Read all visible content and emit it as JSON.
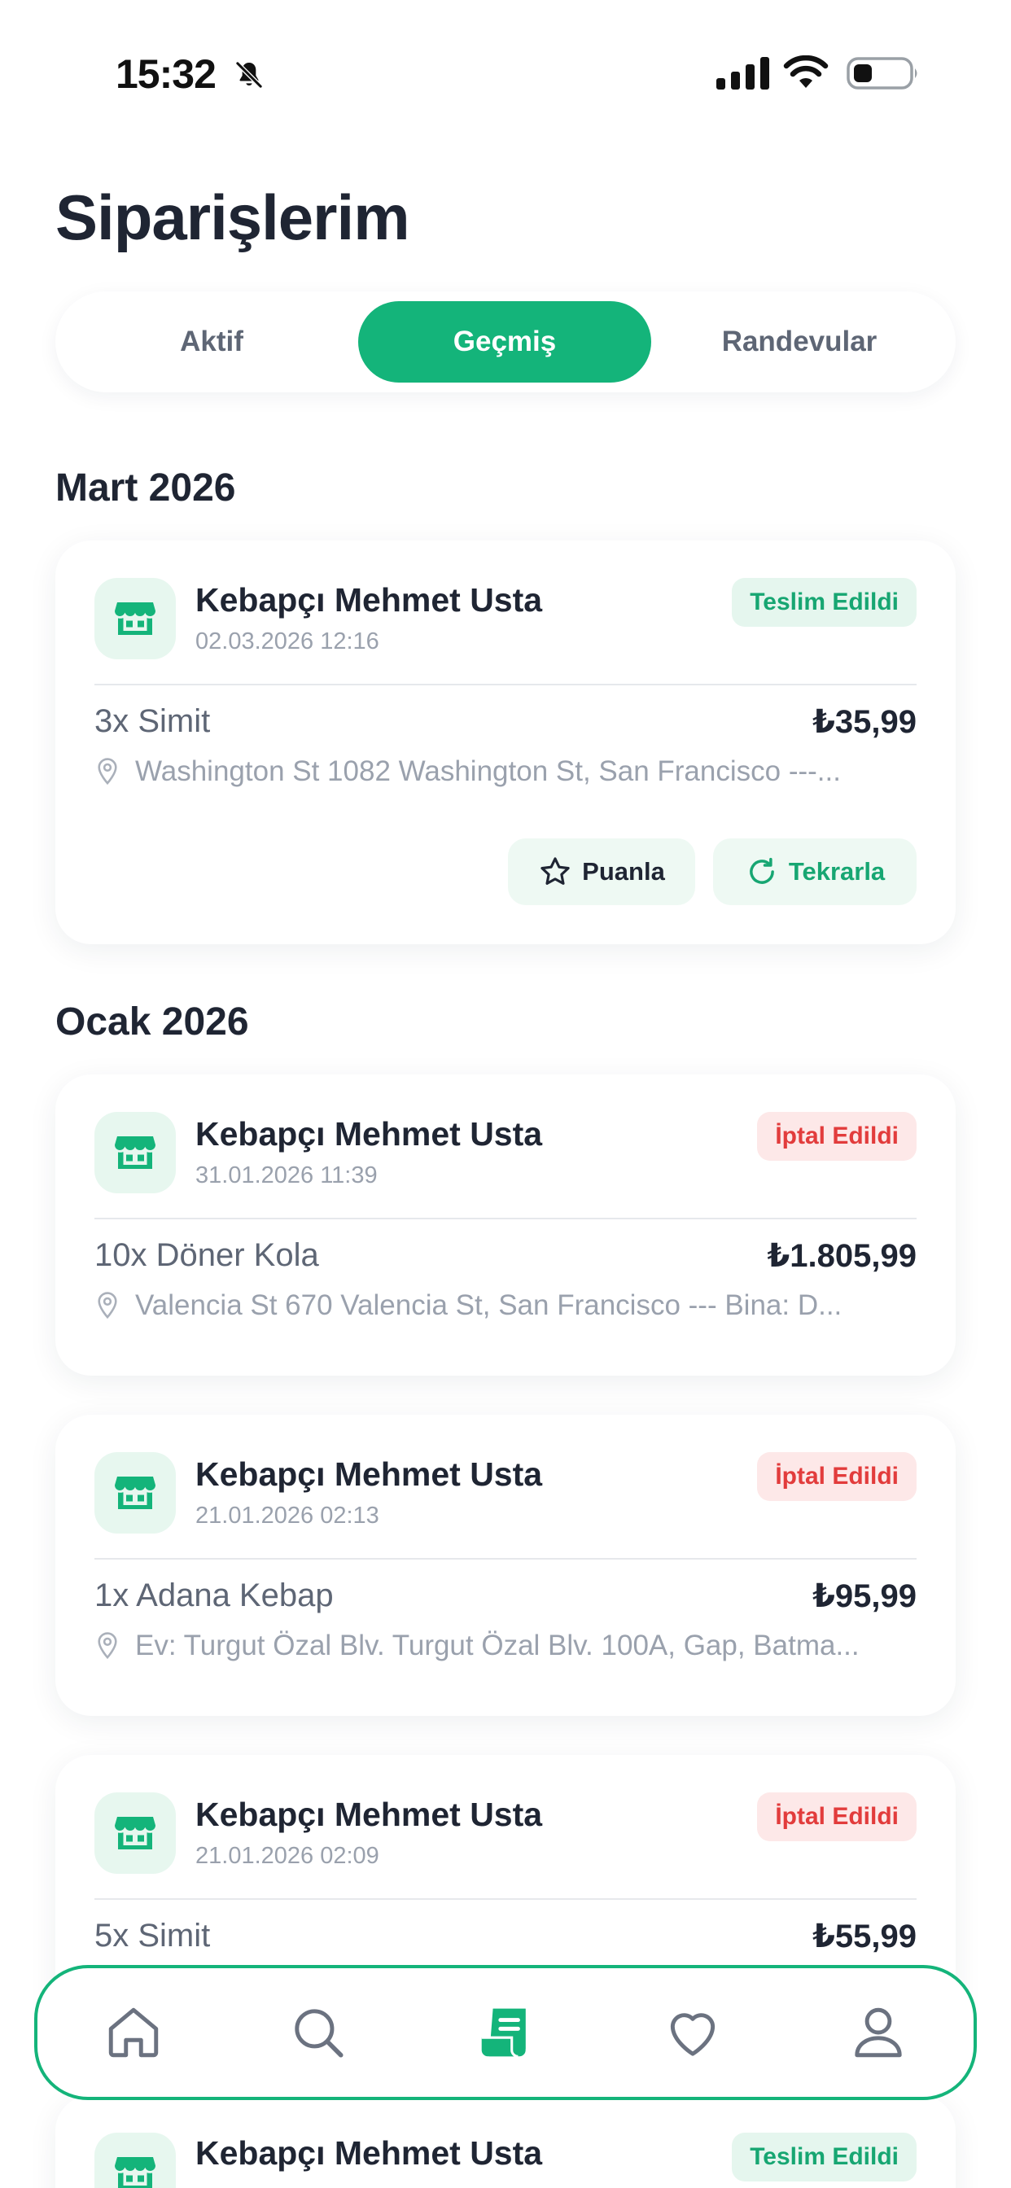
{
  "status_bar": {
    "time": "15:32",
    "icons": [
      "bell-slash-icon",
      "cellular-signal-icon",
      "wifi-icon",
      "battery-icon"
    ]
  },
  "title": "Siparişlerim",
  "tabs": [
    {
      "label": "Aktif",
      "active": false
    },
    {
      "label": "Geçmiş",
      "active": true
    },
    {
      "label": "Randevular",
      "active": false
    }
  ],
  "sections": [
    {
      "title": "Mart 2026",
      "orders": [
        {
          "store": "Kebapçı Mehmet Usta",
          "date": "02.03.2026 12:16",
          "status": "Teslim Edildi",
          "status_type": "delivered",
          "items": "3x Simit",
          "price": "₺35,99",
          "address": "Washington St 1082 Washington St, San Francisco ---...",
          "actions": {
            "rate": "Puanla",
            "repeat": "Tekrarla"
          }
        }
      ]
    },
    {
      "title": "Ocak 2026",
      "orders": [
        {
          "store": "Kebapçı Mehmet Usta",
          "date": "31.01.2026 11:39",
          "status": "İptal Edildi",
          "status_type": "cancelled",
          "items": "10x Döner Kola",
          "price": "₺1.805,99",
          "address": "Valencia St 670 Valencia St, San Francisco --- Bina: D..."
        },
        {
          "store": "Kebapçı Mehmet Usta",
          "date": "21.01.2026 02:13",
          "status": "İptal Edildi",
          "status_type": "cancelled",
          "items": "1x Adana Kebap",
          "price": "₺95,99",
          "address": "Ev: Turgut Özal Blv. Turgut Özal Blv. 100A, Gap, Batma..."
        },
        {
          "store": "Kebapçı Mehmet Usta",
          "date": "21.01.2026 02:09",
          "status": "İptal Edildi",
          "status_type": "cancelled",
          "items": "5x Simit",
          "price": "₺55,99"
        },
        {
          "store": "Kebapçı Mehmet Usta",
          "status": "Teslim Edildi",
          "status_type": "delivered"
        }
      ]
    }
  ],
  "bottom_nav": [
    {
      "name": "home-icon",
      "active": false
    },
    {
      "name": "search-icon",
      "active": false
    },
    {
      "name": "orders-receipt-icon",
      "active": true
    },
    {
      "name": "favorites-heart-icon",
      "active": false
    },
    {
      "name": "profile-user-icon",
      "active": false
    }
  ],
  "colors": {
    "accent": "#14b47a",
    "delivered_bg": "#e5f6ee",
    "delivered_text": "#17a672",
    "cancelled_bg": "#fde8e8",
    "cancelled_text": "#e23c3c",
    "text_primary": "#1f2533",
    "text_muted": "#9aa1ad"
  }
}
